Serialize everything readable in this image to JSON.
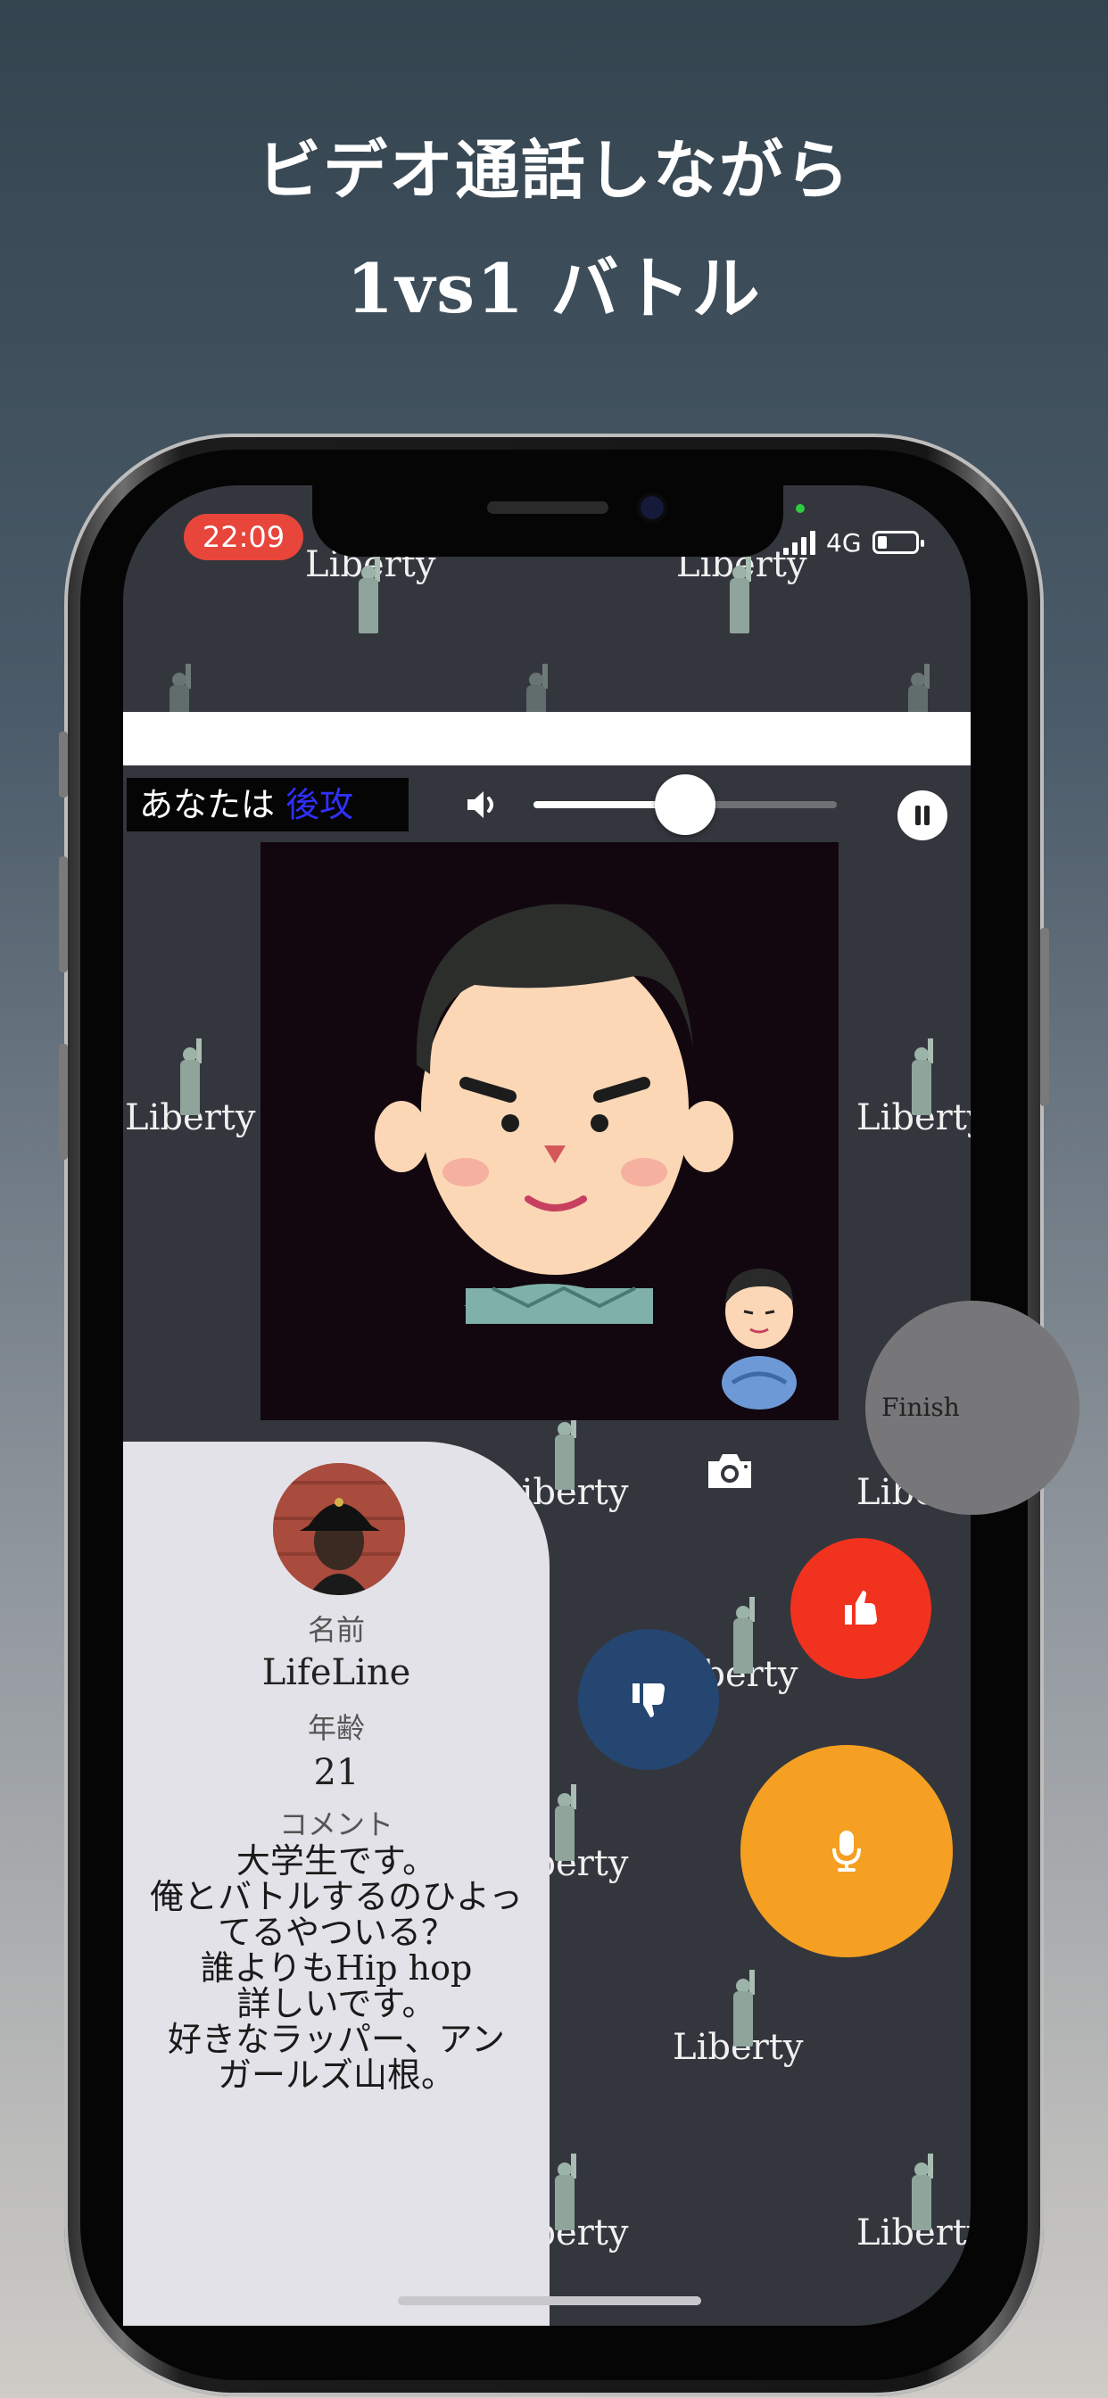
{
  "headline": {
    "line1": "ビデオ通話しながら",
    "line2": "1vs1 バトル"
  },
  "status_bar": {
    "time": "22:09",
    "network": "4G"
  },
  "background_watermark": "Liberty",
  "battle": {
    "turn_prefix": "あなたは",
    "turn_side": "後攻",
    "volume_level": 0.5
  },
  "finish_button": "Finish",
  "profile": {
    "name_label": "名前",
    "name": "LifeLine",
    "age_label": "年齢",
    "age": "21",
    "comment_label": "コメント",
    "comment_lines": [
      "大学生です。",
      "俺とバトルするのひよっ",
      "てるやついる？",
      "誰よりもHip hop",
      "詳しいです。",
      "好きなラッパー、アン",
      "ガールズ山根。"
    ]
  },
  "icons": {
    "volume": "speaker-icon",
    "pause": "pause-icon",
    "camera": "camera-icon",
    "like": "thumbs-up-icon",
    "dislike": "thumbs-down-icon",
    "mic": "microphone-icon"
  },
  "colors": {
    "like": "#f0321f",
    "dislike": "#254671",
    "mic": "#f5a022",
    "time_pill": "#e8453b",
    "turn_side": "#3030ff"
  }
}
